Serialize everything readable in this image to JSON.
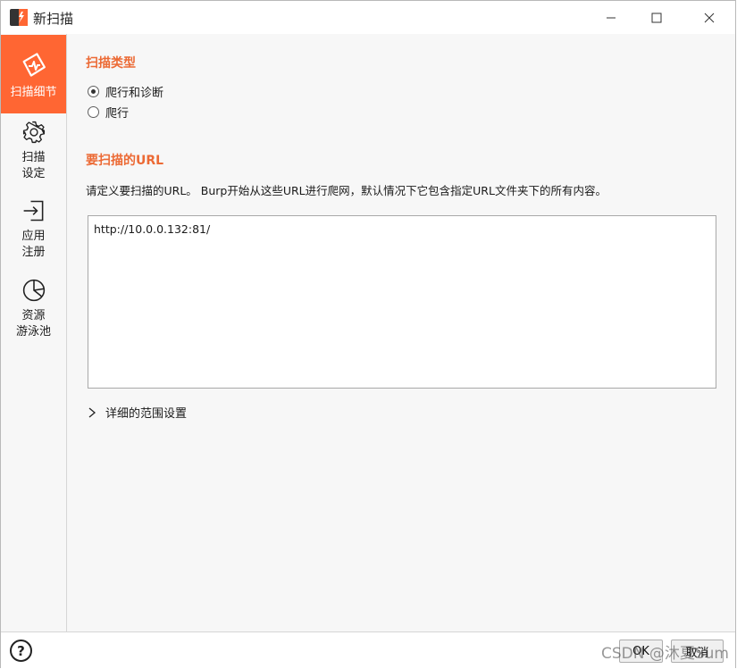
{
  "window": {
    "title": "新扫描"
  },
  "sidebar": {
    "items": [
      {
        "label": "扫描细节",
        "icon": "scan-details-icon",
        "active": true
      },
      {
        "label": "扫描\n设定",
        "icon": "gear-icon",
        "active": false
      },
      {
        "label": "应用\n注册",
        "icon": "login-icon",
        "active": false
      },
      {
        "label": "资源\n游泳池",
        "icon": "pie-chart-icon",
        "active": false
      }
    ]
  },
  "main": {
    "scan_type": {
      "title": "扫描类型",
      "options": [
        {
          "label": "爬行和诊断",
          "checked": true
        },
        {
          "label": "爬行",
          "checked": false
        }
      ]
    },
    "urls": {
      "title": "要扫描的URL",
      "description": "请定义要扫描的URL。 Burp开始从这些URL进行爬网，默认情况下它包含指定URL文件夹下的所有内容。",
      "value": "http://10.0.0.132:81/"
    },
    "detailed_scope": {
      "label": "详细的范围设置"
    }
  },
  "footer": {
    "help": "?",
    "ok_label": "OK",
    "cancel_label": "取消",
    "watermark": "CSDN @沐夏Sum"
  },
  "colors": {
    "accent": "#ff6633",
    "section_title": "#ec6a35"
  }
}
